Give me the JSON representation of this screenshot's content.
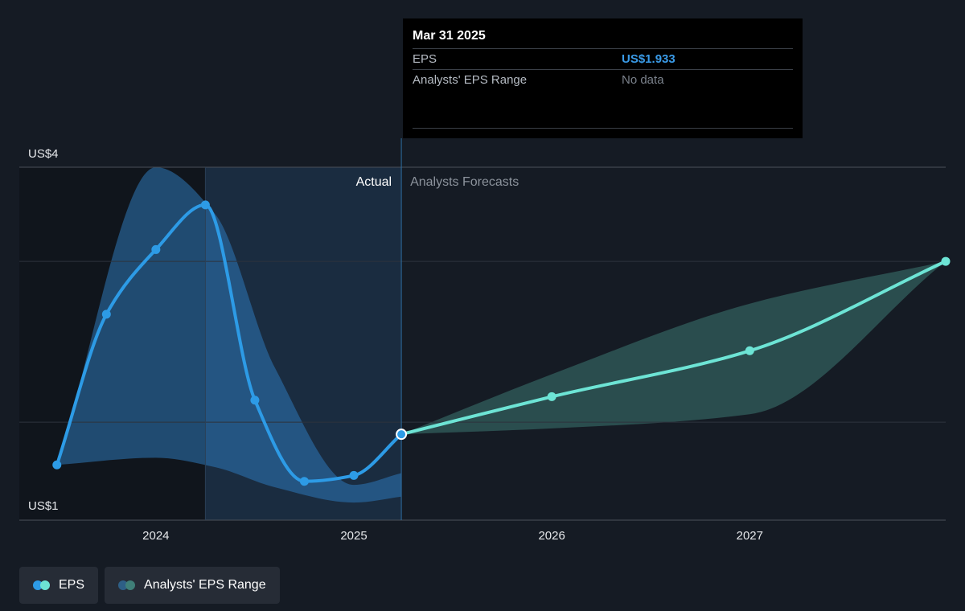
{
  "chart_data": {
    "type": "line",
    "y_axis": {
      "top_label": "US$4",
      "bottom_label": "US$1",
      "ylim": [
        1,
        4
      ],
      "gridlines": [
        1,
        1.833,
        3.2,
        4
      ]
    },
    "x_axis": {
      "ticks": [
        "2024",
        "2025",
        "2026",
        "2027"
      ],
      "tick_values": [
        2024.0,
        2025.0,
        2026.0,
        2027.0
      ],
      "range": [
        2023.31,
        2027.99
      ]
    },
    "divider_x": 2025.24,
    "actual_shade_start": 2024.25,
    "region_labels": {
      "actual": "Actual",
      "forecast": "Analysts Forecasts"
    },
    "series": [
      {
        "name": "EPS",
        "kind": "actual",
        "color": "#2d9be6",
        "points": [
          [
            2023.5,
            1.47
          ],
          [
            2023.75,
            2.75
          ],
          [
            2024.0,
            3.3
          ],
          [
            2024.25,
            3.68
          ],
          [
            2024.5,
            2.02
          ],
          [
            2024.75,
            1.33
          ],
          [
            2025.0,
            1.38
          ],
          [
            2025.24,
            1.73
          ]
        ]
      },
      {
        "name": "EPS",
        "kind": "forecast",
        "color": "#6de4d5",
        "points": [
          [
            2025.24,
            1.73
          ],
          [
            2026.0,
            2.05
          ],
          [
            2027.0,
            2.44
          ],
          [
            2027.99,
            3.2
          ]
        ]
      }
    ],
    "range_bands": [
      {
        "name": "Analysts' EPS Range",
        "kind": "actual",
        "color": "#2e78b8",
        "upper": [
          [
            2023.5,
            1.47
          ],
          [
            2024.0,
            4.0
          ],
          [
            2024.3,
            3.6
          ],
          [
            2024.6,
            2.3
          ],
          [
            2025.0,
            1.3
          ],
          [
            2025.24,
            1.4
          ]
        ],
        "lower": [
          [
            2023.5,
            1.47
          ],
          [
            2024.0,
            1.53
          ],
          [
            2024.3,
            1.45
          ],
          [
            2024.6,
            1.28
          ],
          [
            2025.0,
            1.15
          ],
          [
            2025.24,
            1.2
          ]
        ]
      },
      {
        "name": "Analysts' EPS Range",
        "kind": "forecast",
        "color": "#3f7f78",
        "upper": [
          [
            2025.24,
            1.73
          ],
          [
            2026.0,
            2.24
          ],
          [
            2027.0,
            2.84
          ],
          [
            2027.99,
            3.2
          ]
        ],
        "lower": [
          [
            2025.24,
            1.73
          ],
          [
            2026.0,
            1.78
          ],
          [
            2027.0,
            1.9
          ],
          [
            2027.99,
            3.2
          ]
        ]
      }
    ]
  },
  "tooltip": {
    "date": "Mar 31 2025",
    "rows": [
      {
        "label": "EPS",
        "value": "US$1.933"
      },
      {
        "label": "Analysts' EPS Range",
        "value": "No data"
      }
    ]
  },
  "legend": [
    {
      "label": "EPS",
      "dot_colors": [
        "#2d9be6",
        "#6de4d5"
      ]
    },
    {
      "label": "Analysts' EPS Range",
      "dot_colors": [
        "#2e5f86",
        "#3f7f78"
      ]
    }
  ]
}
